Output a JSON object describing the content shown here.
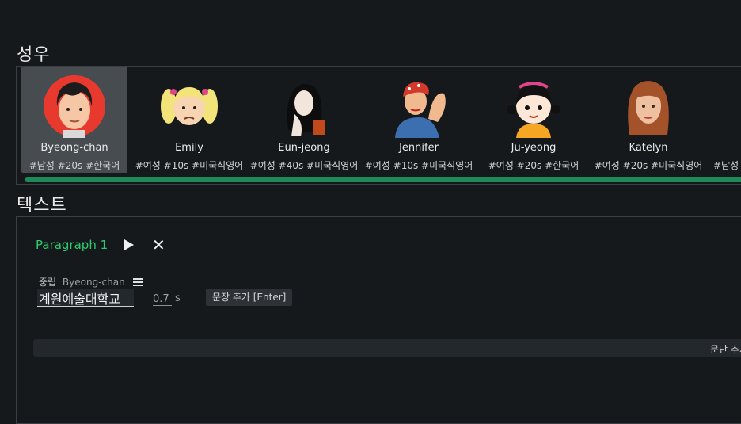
{
  "sections": {
    "voice_title": "성우",
    "text_title": "텍스트"
  },
  "voices": [
    {
      "name": "Byeong-chan",
      "tags": "#남성 #20s #한국어",
      "selected": true,
      "icon": "avatar-byeong-chan"
    },
    {
      "name": "Emily",
      "tags": "#여성 #10s #미국식영어",
      "icon": "avatar-emily"
    },
    {
      "name": "Eun-jeong",
      "tags": "#여성 #40s #미국식영어",
      "icon": "avatar-eun-jeong"
    },
    {
      "name": "Jennifer",
      "tags": "#여성 #10s #미국식영어",
      "icon": "avatar-jennifer"
    },
    {
      "name": "Ju-yeong",
      "tags": "#여성 #20s #한국어",
      "icon": "avatar-ju-yeong"
    },
    {
      "name": "Katelyn",
      "tags": "#여성 #20s #미국식영어",
      "icon": "avatar-katelyn"
    },
    {
      "name": "",
      "tags": "#남성",
      "icon": "avatar-partial"
    }
  ],
  "paragraph": {
    "title": "Paragraph 1",
    "sentence": {
      "emotion": "중립",
      "speaker": "Byeong-chan",
      "text": "계원예술대학교",
      "pause_value": "0.7",
      "pause_unit": "s"
    },
    "add_sentence_label": "문장 추가 [Enter]",
    "add_paragraph_label": "문단 추가"
  },
  "colors": {
    "background": "#15191c",
    "accent": "#2ecc71",
    "scrollbar": "#1f8a58",
    "selected_bg": "#474c51"
  }
}
